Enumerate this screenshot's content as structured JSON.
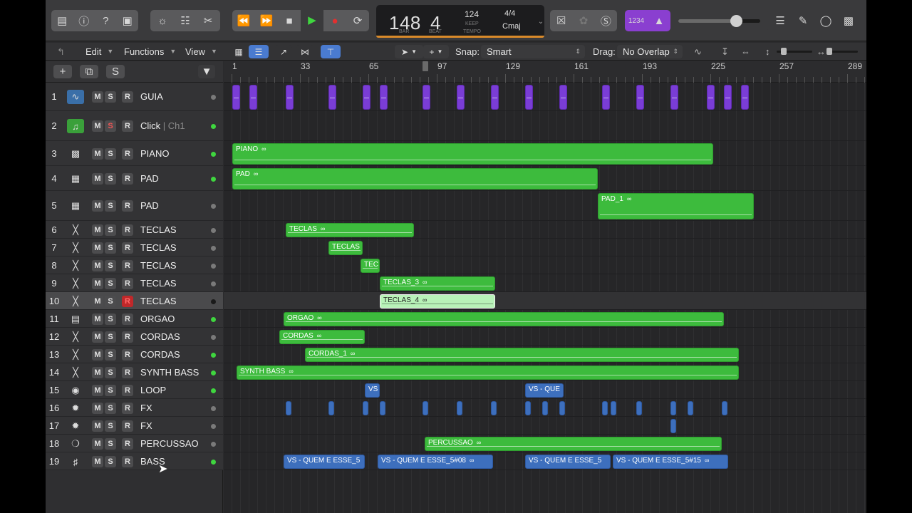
{
  "lcd": {
    "bar": "148",
    "beat": "4",
    "bar_caption": "BAR",
    "beat_caption": "BEAT",
    "tempo": "124",
    "tempo_caption_top": "KEEP",
    "tempo_caption_bottom": "TEMPO",
    "time_signature": "4/4",
    "key": "Cmaj"
  },
  "control_bar": {
    "count_in_label": "1234"
  },
  "master_volume_fraction": 0.7,
  "toolbar": {
    "edit_label": "Edit",
    "functions_label": "Functions",
    "view_label": "View",
    "snap_label": "Snap:",
    "snap_value": "Smart",
    "drag_label": "Drag:",
    "drag_value": "No Overlap"
  },
  "headers": {
    "global_s_label": "S"
  },
  "ruler": {
    "labels": [
      "1",
      "33",
      "65",
      "97",
      "129",
      "161",
      "193",
      "225",
      "257",
      "289"
    ]
  },
  "track_buttons": {
    "mute": "M",
    "solo": "S",
    "record": "R"
  },
  "tracks": [
    {
      "num": "1",
      "name": "GUIA",
      "sub": "",
      "icon": "waveform-icon",
      "dot": "#7a7a7a"
    },
    {
      "num": "2",
      "name": "Click",
      "sub": " | Ch1",
      "icon": "music-note-icon",
      "dot": "#3fd63f"
    },
    {
      "num": "3",
      "name": "PIANO",
      "sub": "",
      "icon": "piano-icon",
      "dot": "#3fd63f"
    },
    {
      "num": "4",
      "name": "PAD",
      "sub": "",
      "icon": "synth-icon",
      "dot": "#3fd63f"
    },
    {
      "num": "5",
      "name": "PAD",
      "sub": "",
      "icon": "synth-icon",
      "dot": "#7a7a7a"
    },
    {
      "num": "6",
      "name": "TECLAS",
      "sub": "",
      "icon": "keyboard-stand-icon",
      "dot": "#7a7a7a"
    },
    {
      "num": "7",
      "name": "TECLAS",
      "sub": "",
      "icon": "keyboard-stand-icon",
      "dot": "#7a7a7a"
    },
    {
      "num": "8",
      "name": "TECLAS",
      "sub": "",
      "icon": "keyboard-stand-icon",
      "dot": "#7a7a7a"
    },
    {
      "num": "9",
      "name": "TECLAS",
      "sub": "",
      "icon": "keyboard-stand-icon",
      "dot": "#7a7a7a"
    },
    {
      "num": "10",
      "name": "TECLAS",
      "sub": "",
      "icon": "keyboard-stand-icon",
      "dot": "#1a1a1a"
    },
    {
      "num": "11",
      "name": "ORGAO",
      "sub": "",
      "icon": "organ-icon",
      "dot": "#3fd63f"
    },
    {
      "num": "12",
      "name": "CORDAS",
      "sub": "",
      "icon": "keyboard-stand-icon",
      "dot": "#7a7a7a"
    },
    {
      "num": "13",
      "name": "CORDAS",
      "sub": "",
      "icon": "keyboard-stand-icon",
      "dot": "#3fd63f"
    },
    {
      "num": "14",
      "name": "SYNTH BASS",
      "sub": "",
      "icon": "keyboard-stand-icon",
      "dot": "#3fd63f"
    },
    {
      "num": "15",
      "name": "LOOP",
      "sub": "",
      "icon": "drum-icon",
      "dot": "#3fd63f"
    },
    {
      "num": "16",
      "name": "FX",
      "sub": "",
      "icon": "starburst-icon",
      "dot": "#7a7a7a"
    },
    {
      "num": "17",
      "name": "FX",
      "sub": "",
      "icon": "starburst-icon",
      "dot": "#7a7a7a"
    },
    {
      "num": "18",
      "name": "PERCUSSAO",
      "sub": "",
      "icon": "percussion-ring-icon",
      "dot": "#7a7a7a"
    },
    {
      "num": "19",
      "name": "BASS",
      "sub": "",
      "icon": "bass-guitar-icon",
      "dot": "#3fd63f"
    }
  ],
  "regions": [
    {
      "lane": 2,
      "label": "PIANO",
      "loop": true,
      "kind": "green",
      "start": 1,
      "end": 226
    },
    {
      "lane": 3,
      "label": "PAD",
      "loop": true,
      "kind": "green",
      "start": 1,
      "end": 172
    },
    {
      "lane": 4,
      "label": "PAD_1",
      "loop": true,
      "kind": "green",
      "start": 172,
      "end": 245
    },
    {
      "lane": 5,
      "label": "TECLAS",
      "loop": true,
      "kind": "green",
      "start": 26,
      "end": 86
    },
    {
      "lane": 6,
      "label": "TECLAS",
      "loop": false,
      "kind": "green",
      "start": 46,
      "end": 62
    },
    {
      "lane": 7,
      "label": "TEC",
      "loop": false,
      "kind": "green",
      "start": 61,
      "end": 70
    },
    {
      "lane": 8,
      "label": "TECLAS_3",
      "loop": true,
      "kind": "green",
      "start": 70,
      "end": 124
    },
    {
      "lane": 9,
      "label": "TECLAS_4",
      "loop": true,
      "kind": "green light",
      "start": 70,
      "end": 124
    },
    {
      "lane": 10,
      "label": "ORGAO",
      "loop": true,
      "kind": "green",
      "start": 25,
      "end": 231
    },
    {
      "lane": 11,
      "label": "CORDAS",
      "loop": true,
      "kind": "green",
      "start": 23,
      "end": 63
    },
    {
      "lane": 12,
      "label": "CORDAS_1",
      "loop": true,
      "kind": "green",
      "start": 35,
      "end": 238
    },
    {
      "lane": 13,
      "label": "SYNTH BASS",
      "loop": true,
      "kind": "green",
      "start": 3,
      "end": 238
    },
    {
      "lane": 14,
      "label": "VS",
      "loop": false,
      "kind": "blue",
      "start": 63,
      "end": 70
    },
    {
      "lane": 14,
      "label": "VS - QUE",
      "loop": false,
      "kind": "blue",
      "start": 138,
      "end": 156
    },
    {
      "lane": 17,
      "label": "PERCUSSAO",
      "loop": true,
      "kind": "green",
      "start": 91,
      "end": 230
    },
    {
      "lane": 18,
      "label": "VS - QUEM E ESSE_5",
      "loop": false,
      "kind": "blue",
      "start": 25,
      "end": 63
    },
    {
      "lane": 18,
      "label": "VS - QUEM E ESSE_5#08",
      "loop": true,
      "kind": "blue",
      "start": 69,
      "end": 123
    },
    {
      "lane": 18,
      "label": "VS - QUEM E ESSE_5",
      "loop": false,
      "kind": "blue",
      "start": 138,
      "end": 178
    },
    {
      "lane": 18,
      "label": "VS - QUEM E ESSE_5#15",
      "loop": true,
      "kind": "blue",
      "start": 179,
      "end": 233
    }
  ],
  "guia_clips": [
    1,
    9,
    26,
    46,
    62,
    70,
    90,
    106,
    122,
    138,
    154,
    174,
    190,
    206,
    223,
    231,
    239
  ],
  "fx_clips": [
    26,
    46,
    62,
    70,
    90,
    106,
    122,
    138,
    146,
    154,
    174,
    178,
    190,
    206,
    214,
    230
  ],
  "fx2_clips": [
    206
  ]
}
